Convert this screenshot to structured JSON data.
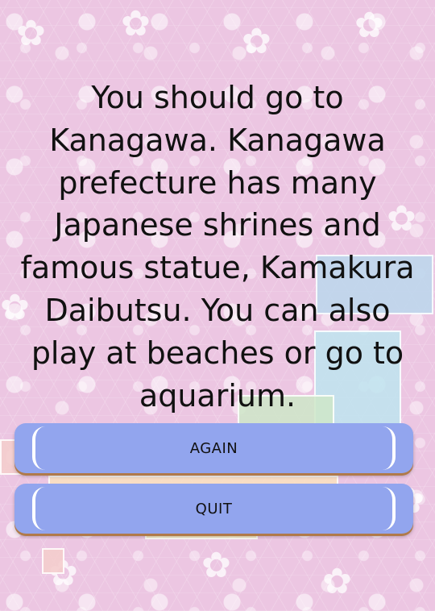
{
  "result": {
    "message": "You should go to Kanagawa. Kanagawa prefecture has many Japanese shrines and famous statue, Kamakura Daibutsu. You can also play at beaches or go to aquarium."
  },
  "buttons": {
    "again_label": "AGAIN",
    "quit_label": "QUIT"
  },
  "colors": {
    "background": "#ecc6e2",
    "button": "#92a5ee",
    "button_shadow": "#b07a4a",
    "text": "#111111"
  }
}
